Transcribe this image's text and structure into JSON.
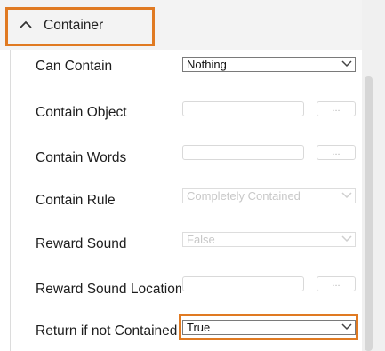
{
  "section": {
    "title": "Container",
    "expanded": true,
    "accent_color": "#e07a22"
  },
  "rows": [
    {
      "label": "Can Contain",
      "control": "select",
      "value": "Nothing",
      "enabled": true
    },
    {
      "label": "Contain Object",
      "control": "text-with-browse",
      "value": "",
      "button_label": "...",
      "enabled": false
    },
    {
      "label": "Contain Words",
      "control": "text-with-browse",
      "value": "",
      "button_label": "...",
      "enabled": false
    },
    {
      "label": "Contain Rule",
      "control": "select",
      "value": "Completely Contained",
      "enabled": false
    },
    {
      "label": "Reward Sound",
      "control": "select",
      "value": "False",
      "enabled": false
    },
    {
      "label": "Reward Sound Location",
      "control": "text-with-browse",
      "value": "",
      "button_label": "...",
      "enabled": false
    },
    {
      "label": "Return if not Contained",
      "control": "select",
      "value": "True",
      "enabled": true,
      "highlighted": true
    }
  ]
}
